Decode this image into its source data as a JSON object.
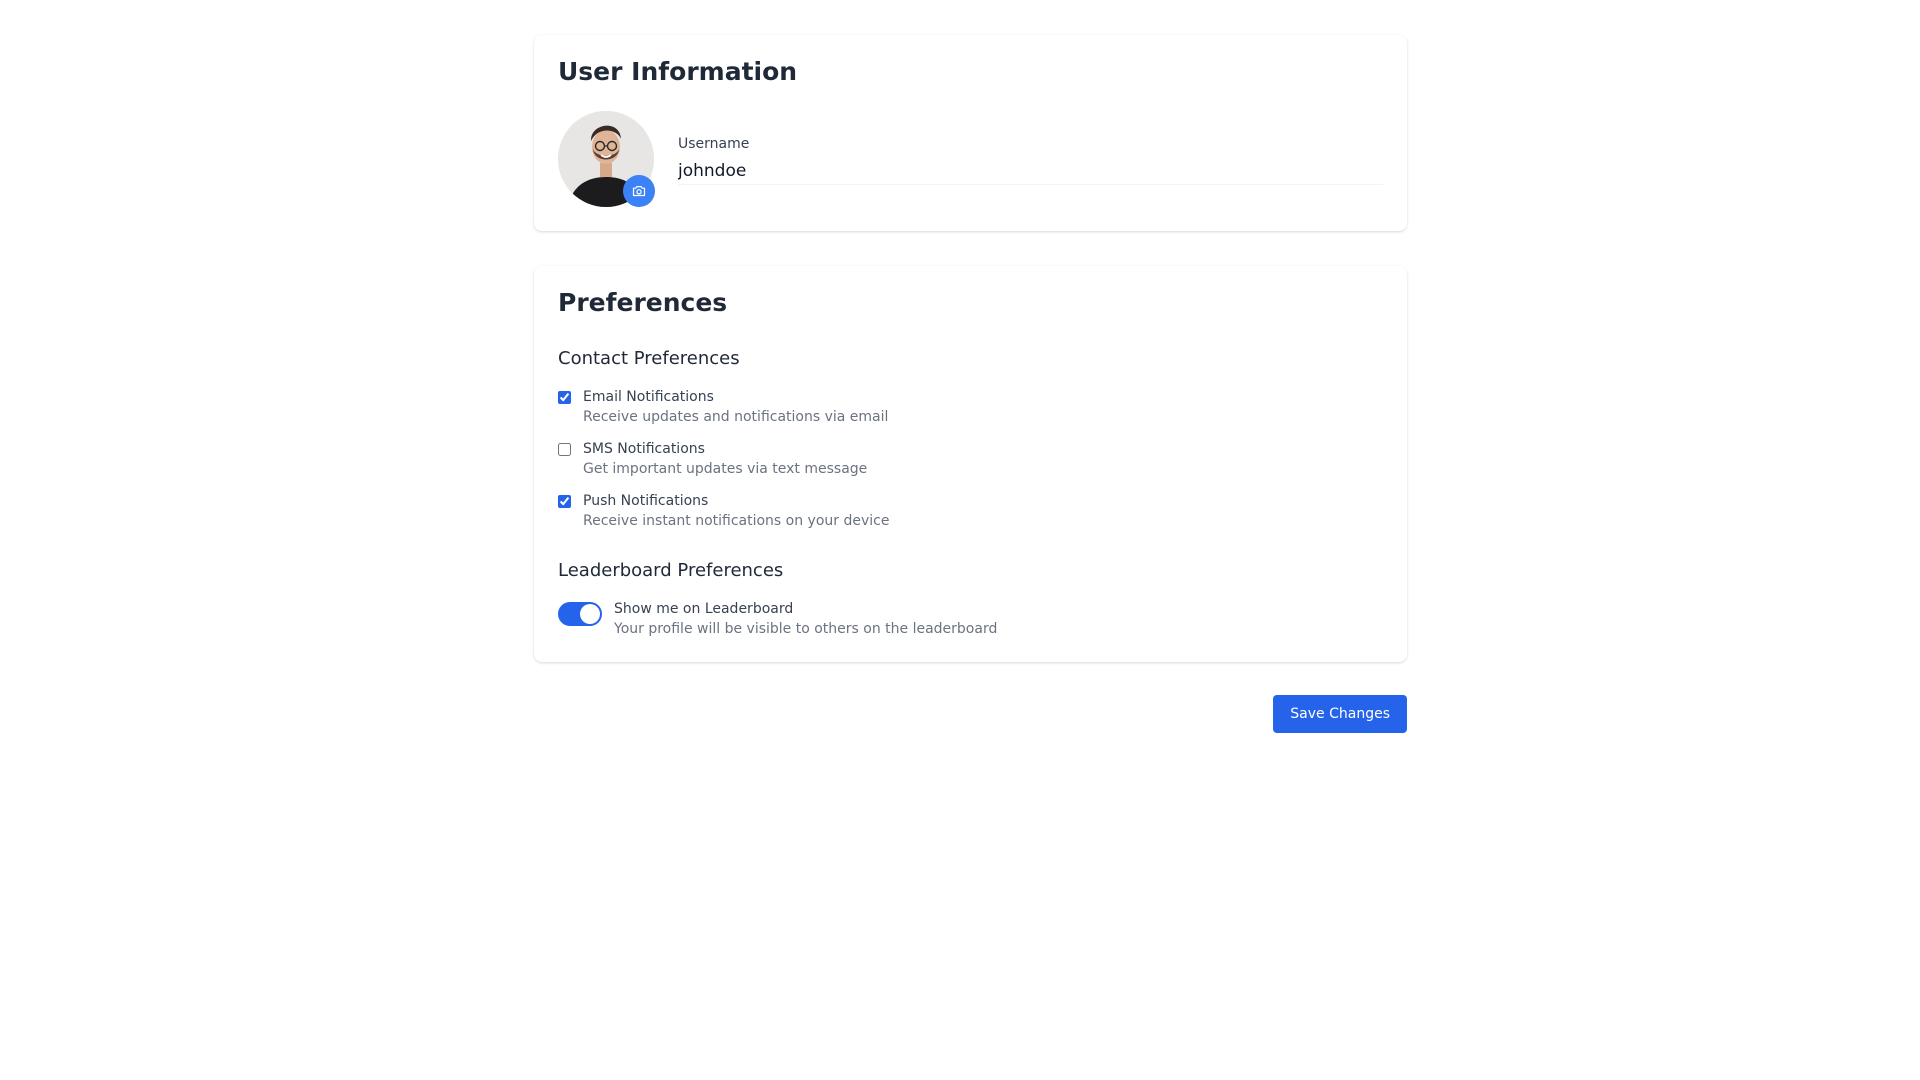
{
  "user_info": {
    "title": "User Information",
    "username_label": "Username",
    "username_value": "johndoe",
    "avatar_icon": "profile-photo",
    "camera_icon": "camera-icon"
  },
  "preferences": {
    "title": "Preferences",
    "contact": {
      "title": "Contact Preferences",
      "options": [
        {
          "label": "Email Notifications",
          "description": "Receive updates and notifications via email",
          "checked": true
        },
        {
          "label": "SMS Notifications",
          "description": "Get important updates via text message",
          "checked": false
        },
        {
          "label": "Push Notifications",
          "description": "Receive instant notifications on your device",
          "checked": true
        }
      ]
    },
    "leaderboard": {
      "title": "Leaderboard Preferences",
      "toggle_label": "Show me on Leaderboard",
      "toggle_description": "Your profile will be visible to others on the leaderboard",
      "enabled": true
    }
  },
  "actions": {
    "save_label": "Save Changes"
  },
  "colors": {
    "accent": "#2563eb",
    "camera_badge": "#3b82f6"
  }
}
